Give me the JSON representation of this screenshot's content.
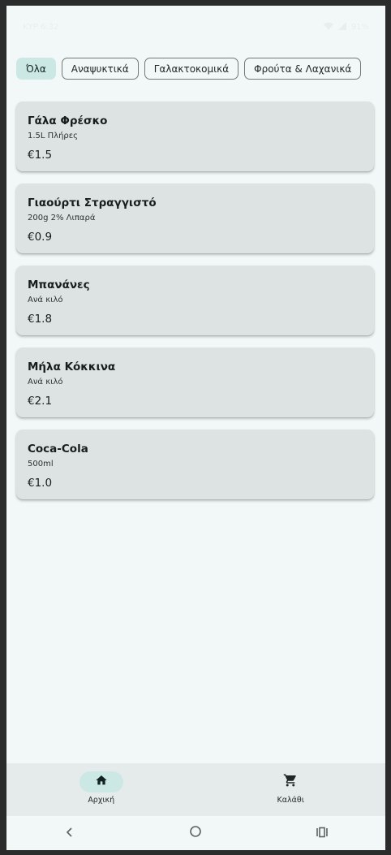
{
  "status_bar": {
    "left_text": "ΚΥΡ 6:32",
    "right_text": "91%"
  },
  "categories": [
    {
      "label": "Όλα",
      "selected": true
    },
    {
      "label": "Αναψυκτικά",
      "selected": false
    },
    {
      "label": "Γαλακτοκομικά",
      "selected": false
    },
    {
      "label": "Φρούτα & Λαχανικά",
      "selected": false
    }
  ],
  "products": [
    {
      "name": "Γάλα Φρέσκο",
      "description": "1.5L Πλήρες",
      "price": "€1.5"
    },
    {
      "name": "Γιαούρτι Στραγγιστό",
      "description": "200g 2% Λιπαρά",
      "price": "€0.9"
    },
    {
      "name": "Μπανάνες",
      "description": "Ανά κιλό",
      "price": "€1.8"
    },
    {
      "name": "Μήλα Κόκκινα",
      "description": "Ανά κιλό",
      "price": "€2.1"
    },
    {
      "name": "Coca-Cola",
      "description": "500ml",
      "price": "€1.0"
    }
  ],
  "bottom_nav": {
    "items": [
      {
        "label": "Αρχική",
        "icon": "home-icon",
        "active": true
      },
      {
        "label": "Καλάθι",
        "icon": "cart-icon",
        "active": false
      }
    ]
  },
  "colors": {
    "background": "#f2f8f7",
    "card": "#dde3e2",
    "accent": "#cce8e5",
    "text": "#161d1c"
  }
}
